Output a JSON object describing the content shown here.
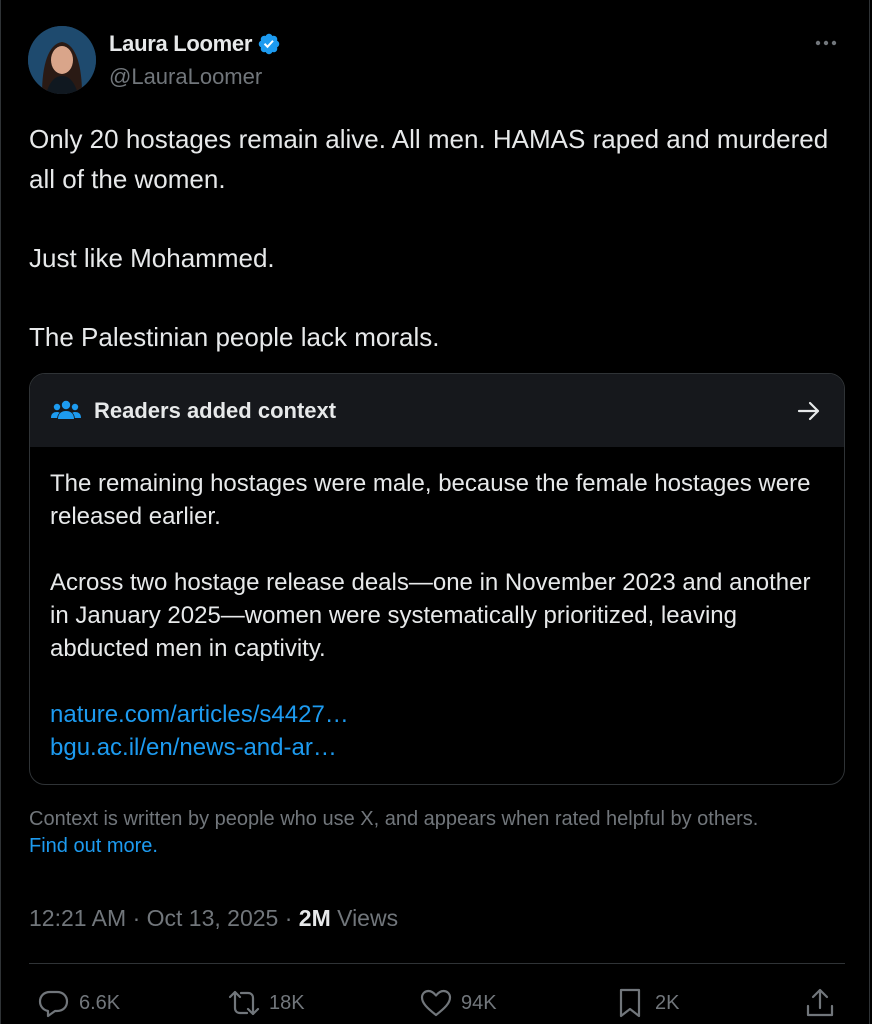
{
  "author": {
    "display_name": "Laura Loomer",
    "handle": "@LauraLoomer",
    "verified": true
  },
  "tweet": {
    "paragraphs": [
      "Only 20 hostages remain alive. All men. HAMAS raped and murdered all of the women.",
      "Just like Mohammed.",
      "The Palestinian people lack morals."
    ]
  },
  "note": {
    "title": "Readers added context",
    "paragraphs": [
      "The remaining hostages were male, because the female hostages were released earlier.",
      "Across two hostage release deals—one in November 2023 and another in January 2025—women were systematically prioritized, leaving abducted men in captivity."
    ],
    "links": [
      "nature.com/articles/s4427…",
      "bgu.ac.il/en/news-and-ar…"
    ],
    "disclaimer": "Context is written by people who use X, and appears when rated helpful by others.",
    "find_out_more": "Find out more."
  },
  "meta": {
    "time": "12:21 AM",
    "sep1": "·",
    "date": "Oct 13, 2025",
    "sep2": "·",
    "views_count": "2M",
    "views_label": "Views"
  },
  "actions": {
    "replies": "6.6K",
    "reposts": "18K",
    "likes": "94K",
    "bookmarks": "2K"
  },
  "colors": {
    "background": "#000000",
    "text": "#e7e9ea",
    "muted": "#71767b",
    "accent": "#1d9bf0",
    "note_header": "#16181c",
    "border": "#2f3336"
  }
}
